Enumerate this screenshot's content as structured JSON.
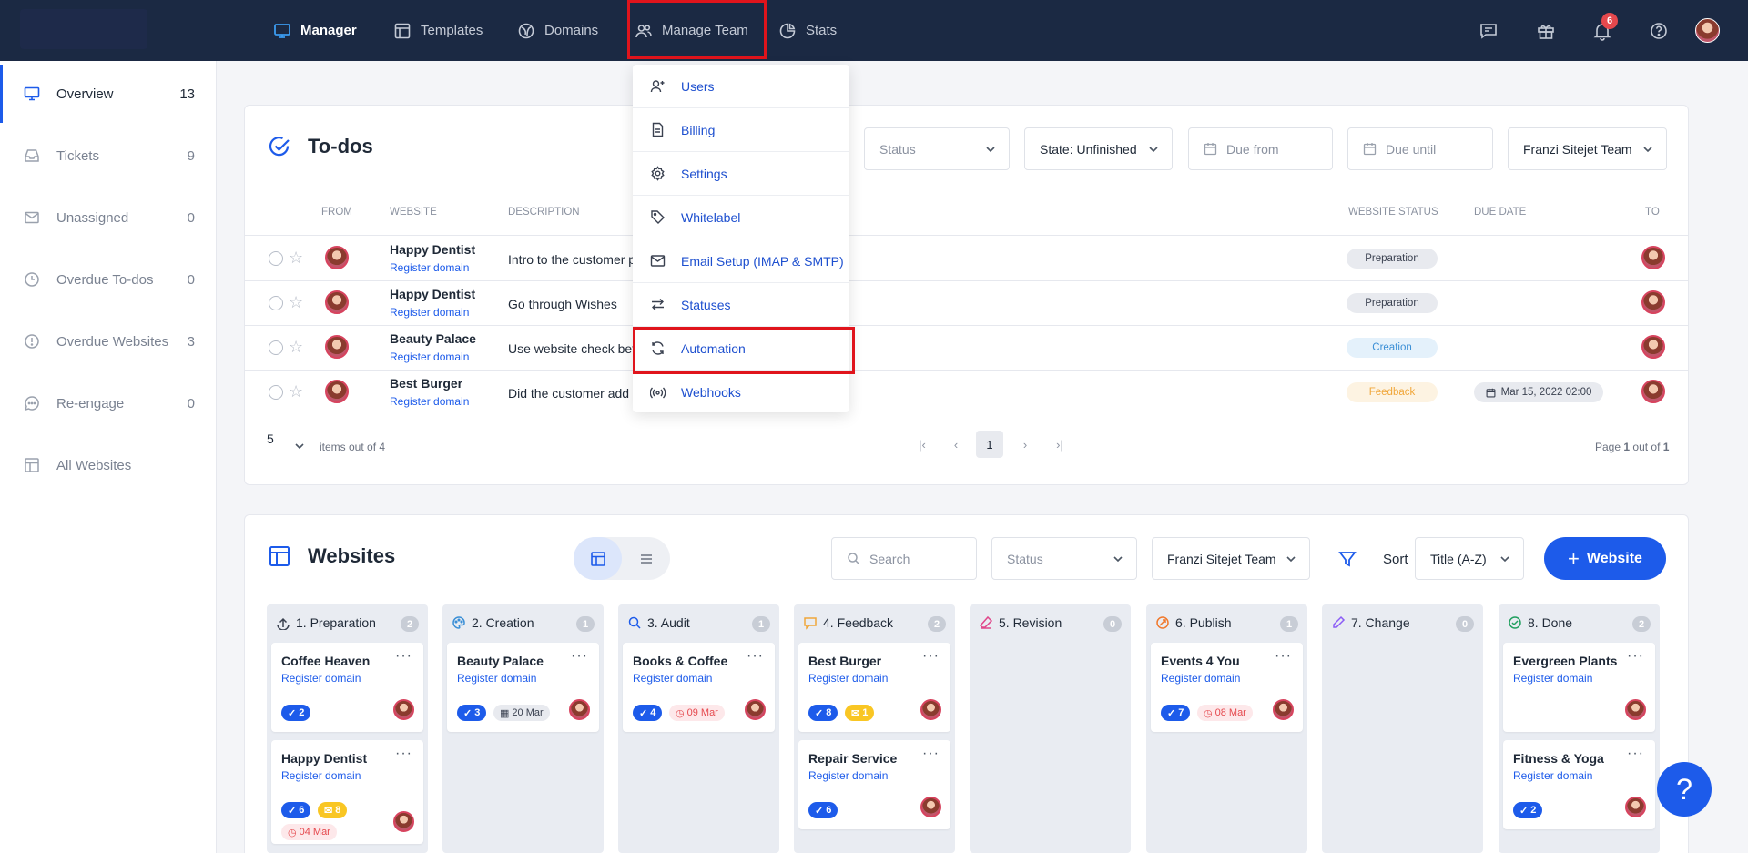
{
  "topnav": {
    "items": [
      {
        "label": "Manager",
        "icon": "monitor-icon"
      },
      {
        "label": "Templates",
        "icon": "template-icon"
      },
      {
        "label": "Domains",
        "icon": "globe-icon"
      },
      {
        "label": "Manage Team",
        "icon": "users-icon"
      },
      {
        "label": "Stats",
        "icon": "pie-chart-icon"
      }
    ],
    "notification_count": "6",
    "right_icons": [
      "chat-icon",
      "gift-icon",
      "bell-icon",
      "help-icon",
      "avatar"
    ]
  },
  "sidebar": {
    "items": [
      {
        "label": "Overview",
        "count": "13"
      },
      {
        "label": "Tickets",
        "count": "9"
      },
      {
        "label": "Unassigned",
        "count": "0"
      },
      {
        "label": "Overdue To-dos",
        "count": "0"
      },
      {
        "label": "Overdue Websites",
        "count": "3"
      },
      {
        "label": "Re-engage",
        "count": "0"
      },
      {
        "label": "All Websites",
        "count": ""
      }
    ]
  },
  "todos": {
    "title": "To-dos",
    "filters": {
      "status": "Status",
      "state": "State: Unfinished",
      "due_from": "Due from",
      "due_until": "Due until",
      "team": "Franzi Sitejet Team"
    },
    "headers": {
      "from": "From",
      "website": "Website",
      "description": "Description",
      "website_status": "Website Status",
      "due_date": "Due Date",
      "to": "To"
    },
    "rows": [
      {
        "website": "Happy Dentist",
        "link": "Register domain",
        "description": "Intro to the customer p",
        "status": "Preparation",
        "due": ""
      },
      {
        "website": "Happy Dentist",
        "link": "Register domain",
        "description": "Go through Wishes",
        "status": "Preparation",
        "due": ""
      },
      {
        "website": "Beauty Palace",
        "link": "Register domain",
        "description": "Use website check bef",
        "status": "Creation",
        "due": ""
      },
      {
        "website": "Best Burger",
        "link": "Register domain",
        "description": "Did the customer add f",
        "status": "Feedback",
        "due": "Mar 15, 2022 02:00"
      }
    ],
    "pager": {
      "page_size": "5",
      "items_text": "items out of 4",
      "current_page": "1",
      "page_info_prefix": "Page",
      "page_info_current": "1",
      "page_info_mid": "out of",
      "page_info_total": "1"
    }
  },
  "dropdown": {
    "items": [
      {
        "label": "Users",
        "icon": "user-plus-icon"
      },
      {
        "label": "Billing",
        "icon": "document-icon"
      },
      {
        "label": "Settings",
        "icon": "gear-icon"
      },
      {
        "label": "Whitelabel",
        "icon": "tag-icon"
      },
      {
        "label": "Email Setup (IMAP & SMTP)",
        "icon": "mail-icon"
      },
      {
        "label": "Statuses",
        "icon": "arrows-icon"
      },
      {
        "label": "Automation",
        "icon": "refresh-icon"
      },
      {
        "label": "Webhooks",
        "icon": "webhook-icon"
      }
    ]
  },
  "websites": {
    "title": "Websites",
    "search_placeholder": "Search",
    "status_filter": "Status",
    "team_filter": "Franzi Sitejet Team",
    "sort_label": "Sort",
    "sort_value": "Title (A-Z)",
    "add_button": "Website",
    "columns": [
      {
        "label": "1. Preparation",
        "count": "2",
        "icon": "upload-icon",
        "icon_color": "#3a4150",
        "cards": [
          {
            "title": "Coffee Heaven",
            "link": "Register domain",
            "todos": "2"
          },
          {
            "title": "Happy Dentist",
            "link": "Register domain",
            "todos": "6",
            "mails": "8",
            "date": "04 Mar"
          }
        ]
      },
      {
        "label": "2. Creation",
        "count": "1",
        "icon": "palette-icon",
        "icon_color": "#3b8fd6",
        "cards": [
          {
            "title": "Beauty Palace",
            "link": "Register domain",
            "todos": "3",
            "date": "20 Mar"
          }
        ]
      },
      {
        "label": "3. Audit",
        "count": "1",
        "icon": "search-icon",
        "icon_color": "#1d5bea",
        "cards": [
          {
            "title": "Books & Coffee",
            "link": "Register domain",
            "todos": "4",
            "date": "09 Mar"
          }
        ]
      },
      {
        "label": "4. Feedback",
        "count": "2",
        "icon": "comment-icon",
        "icon_color": "#f0a63a",
        "cards": [
          {
            "title": "Best Burger",
            "link": "Register domain",
            "todos": "8",
            "mails": "1"
          },
          {
            "title": "Repair Service",
            "link": "Register domain",
            "todos": "6"
          }
        ]
      },
      {
        "label": "5. Revision",
        "count": "0",
        "icon": "eraser-icon",
        "icon_color": "#e0468a",
        "cards": []
      },
      {
        "label": "6. Publish",
        "count": "1",
        "icon": "rocket-icon",
        "icon_color": "#f0782c",
        "cards": [
          {
            "title": "Events 4 You",
            "link": "Register domain",
            "todos": "7",
            "date": "08 Mar"
          }
        ]
      },
      {
        "label": "7. Change",
        "count": "0",
        "icon": "pen-icon",
        "icon_color": "#8b5cf6",
        "cards": []
      },
      {
        "label": "8. Done",
        "count": "2",
        "icon": "check-circle-icon",
        "icon_color": "#22a060",
        "cards": [
          {
            "title": "Evergreen Plants",
            "link": "Register domain"
          },
          {
            "title": "Fitness & Yoga",
            "link": "Register domain",
            "todos": "2"
          }
        ]
      }
    ]
  },
  "help_fab": "?"
}
